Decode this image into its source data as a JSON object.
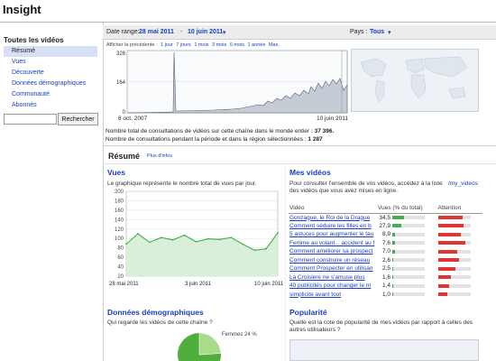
{
  "app": {
    "title": "Insight"
  },
  "sidebar": {
    "title": "Toutes les vidéos",
    "items": [
      {
        "label": "Résumé",
        "selected": true
      },
      {
        "label": "Vues"
      },
      {
        "label": "Découverte"
      },
      {
        "label": "Données démographiques"
      },
      {
        "label": "Communauté"
      },
      {
        "label": "Abonnés"
      }
    ],
    "search_value": "",
    "search_button": "Rechercher"
  },
  "range": {
    "label": "Date range:",
    "start": "28 mai 2011",
    "separator": "-",
    "end": "10 juin 2011",
    "arrow": "▾",
    "country_label": "Pays :",
    "country_value": "Tous",
    "previous_label": "Afficher la précédente :",
    "previous_options": [
      "1 jour",
      "7 jours",
      "1 mois",
      "3 mois",
      "6 mois",
      "1 année",
      "Max."
    ]
  },
  "overview": {
    "y_ticks": [
      "328",
      "164",
      "0"
    ],
    "x_start": "8 oct. 2007",
    "x_end": "10 juin 2011"
  },
  "totals": {
    "world_label": "Nombre total de consultations de vidéos sur cette chaîne dans le monde entier :",
    "world_value": "37 396.",
    "region_label": "Nombre de consultations pendant la période et dans la région sélectionnées :",
    "region_value": "1 287"
  },
  "summary": {
    "title": "Résumé",
    "more": "Plus d'infos"
  },
  "views": {
    "title": "Vues",
    "desc": "Le graphique représente le nombre total de vues par jour.",
    "x_labels": [
      "28 mai 2011",
      "3 juin 2011",
      "10 juin 2011"
    ]
  },
  "chart_data": {
    "type": "line",
    "title": "Vues",
    "x": [
      "28 mai",
      "29 mai",
      "30 mai",
      "31 mai",
      "1 juin",
      "2 juin",
      "3 juin",
      "4 juin",
      "5 juin",
      "6 juin",
      "7 juin",
      "8 juin",
      "9 juin",
      "10 juin"
    ],
    "series": [
      {
        "values": [
          88,
          110,
          92,
          102,
          97,
          107,
          93,
          99,
          98,
          102,
          88,
          75,
          78,
          112
        ]
      }
    ],
    "yticks": [
      20,
      40,
      60,
      80,
      100,
      120,
      140,
      160,
      180,
      200
    ],
    "ylim": [
      20,
      200
    ],
    "grid": true,
    "color": "#3fb24c"
  },
  "my_videos": {
    "title": "Mes vidéos",
    "desc": "Pour consulter l'ensemble de vos vidéos, accédez à la liste des vidéos que vous avez mises en ligne.",
    "link": "/my_videos",
    "headers": [
      "Vidéo",
      "Vues (% du total)",
      "Attention"
    ],
    "rows": [
      {
        "title": "Gonzague, le Roi de la Drague",
        "pct": "34,5",
        "views_frac": 0.35,
        "attention_frac": 0.75
      },
      {
        "title": "Comment séduire les filles en b",
        "pct": "27,9",
        "views_frac": 0.28,
        "attention_frac": 0.8
      },
      {
        "title": "5 astuces pour augmenter le tau",
        "pct": "8,9",
        "views_frac": 0.09,
        "attention_frac": 0.7
      },
      {
        "title": "Femme au volant... accident au f",
        "pct": "7,6",
        "views_frac": 0.08,
        "attention_frac": 0.85
      },
      {
        "title": "Comment améliorer sa prospect",
        "pct": "7,0",
        "views_frac": 0.07,
        "attention_frac": 0.6
      },
      {
        "title": "Comment construire un réseau",
        "pct": "2,6",
        "views_frac": 0.03,
        "attention_frac": 0.65
      },
      {
        "title": "Comment Prospecter en utilisan",
        "pct": "2,5",
        "views_frac": 0.03,
        "attention_frac": 0.55
      },
      {
        "title": "La Croisiere ne s'amuse plus",
        "pct": "1,6",
        "views_frac": 0.02,
        "attention_frac": 0.4
      },
      {
        "title": "40 publicités pour changer le m",
        "pct": "1,4",
        "views_frac": 0.02,
        "attention_frac": 0.35
      },
      {
        "title": "simplicite avant tout",
        "pct": "1,0",
        "views_frac": 0.01,
        "attention_frac": 0.3
      }
    ]
  },
  "demographics": {
    "title": "Données démographiques",
    "desc": "Qui regarde les vidéos de cette chaîne ?",
    "pie_label": "Femmes 24 %",
    "female_frac": 0.24
  },
  "popularity": {
    "title": "Popularité",
    "desc": "Quelle est la cote de popularité de mes vidéos par rapport à celles des autres utilisateurs ?"
  }
}
